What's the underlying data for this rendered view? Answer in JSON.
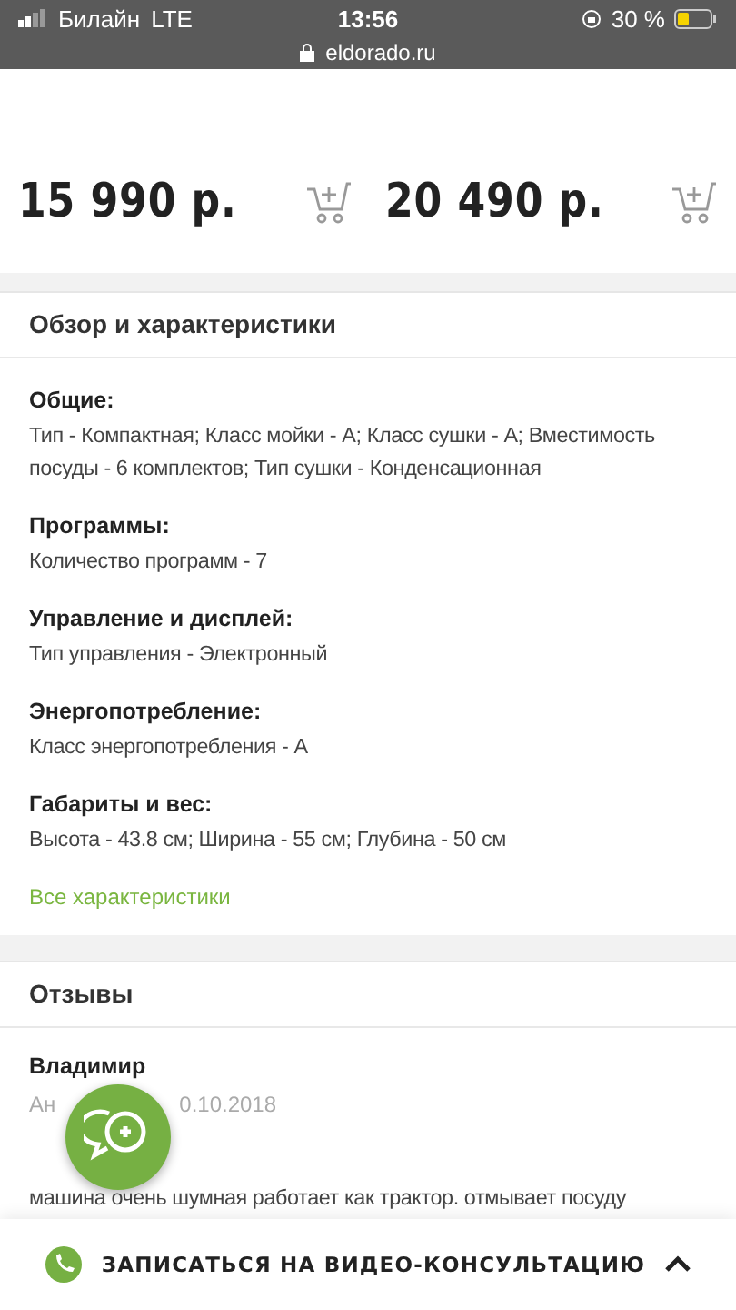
{
  "status_bar": {
    "carrier": "Билайн",
    "network": "LTE",
    "time": "13:56",
    "url": "eldorado.ru",
    "battery": "30 %"
  },
  "prices": [
    {
      "price": "15 990 р."
    },
    {
      "price": "20 490 р."
    }
  ],
  "specs": {
    "title": "Обзор и характеристики",
    "groups": [
      {
        "heading": "Общие:",
        "text": "Тип - Компактная; Класс мойки - А; Класс сушки - А; Вместимость посуды - 6 комплектов; Тип сушки - Конденсационная"
      },
      {
        "heading": "Программы:",
        "text": "Количество программ - 7"
      },
      {
        "heading": "Управление и дисплей:",
        "text": "Тип управления - Электронный"
      },
      {
        "heading": "Энергопотребление:",
        "text": "Класс энергопотребления - А"
      },
      {
        "heading": "Габариты и вес:",
        "text": "Высота - 43.8 см; Ширина - 55 см; Глубина - 50 см"
      }
    ],
    "link": "Все характеристики"
  },
  "reviews": {
    "title": "Отзывы",
    "items": [
      {
        "author": "Владимир",
        "date_start": "Ан",
        "date_end": "0.10.2018",
        "text": "машина очень шумная работает как трактор. отмывает посуду"
      }
    ]
  },
  "bottom_bar": {
    "label": "ЗАПИСАТЬСЯ НА ВИДЕО-КОНСУЛЬТАЦИЮ"
  }
}
